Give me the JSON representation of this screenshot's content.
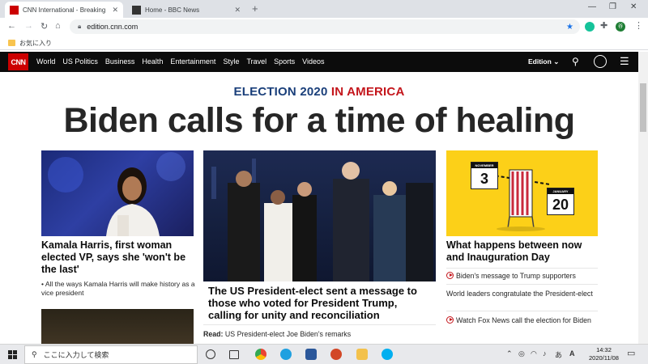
{
  "browser": {
    "tabs": [
      {
        "label": "CNN International - Breaking Ne",
        "active": true
      },
      {
        "label": "Home - BBC News",
        "active": false
      }
    ],
    "new_tab": "+",
    "url": "edition.cnn.com",
    "bookmarks": [
      {
        "label": "お気に入り"
      }
    ],
    "profile_initial": "谷"
  },
  "cnn": {
    "logo": "CNN",
    "nav": [
      "World",
      "US Politics",
      "Business",
      "Health",
      "Entertainment",
      "Style",
      "Travel",
      "Sports",
      "Videos"
    ],
    "edition": "Edition",
    "kicker_blue": "ELECTION 2020",
    "kicker_red": "IN AMERICA",
    "headline": "Biden calls for a time of healing",
    "left_story": {
      "title": "Kamala Harris, first woman elected VP, says she 'won't be the last'",
      "bullet": "• All the ways Kamala Harris will make history as a vice president"
    },
    "center_story": {
      "title": "The US President-elect sent a message to those who voted for President Trump, calling for unity and reconciliation",
      "read_label": "Read:",
      "read_text": "US President-elect Joe Biden's remarks"
    },
    "right_story": {
      "graphic_month1": "NOVEMBER",
      "graphic_day1": "3",
      "graphic_month2": "JANUARY",
      "graphic_day2": "20",
      "title": "What happens between now and Inauguration Day",
      "related": [
        {
          "text": "Biden's message to Trump supporters",
          "video": true
        },
        {
          "text": "World leaders congratulate the President-elect",
          "video": false
        },
        {
          "text": "Watch Fox News call the election for Biden",
          "video": true
        }
      ]
    }
  },
  "taskbar": {
    "search_placeholder": "ここに入力して検索",
    "time": "14:32",
    "date": "2020/11/08",
    "ime": "A"
  },
  "colors": {
    "cnn_red": "#cc0000",
    "kicker_blue": "#1a3f7a",
    "kicker_red": "#c4161c",
    "graphic_yellow": "#fcd018"
  }
}
